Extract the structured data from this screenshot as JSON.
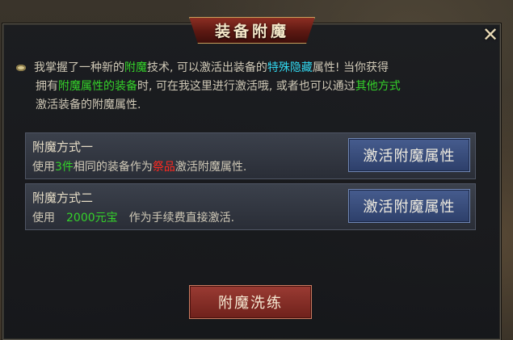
{
  "window": {
    "title": "装备附魔",
    "close_icon": "close-icon"
  },
  "intro": {
    "l1_a": "我掌握了一种新的",
    "l1_hl1": "附魔",
    "l1_b": "技术, 可以激活出装备的",
    "l1_hl2": "特殊隐藏",
    "l1_c": "属性! 当你获得",
    "l2_a": "拥有",
    "l2_hl1": "附魔属性的装备",
    "l2_b": "时, 可在我这里进行激活哦, 或者也可以通过",
    "l2_hl2": "其他方式",
    "l3": "激活装备的附魔属性."
  },
  "methods": [
    {
      "title": "附魔方式一",
      "desc_a": "使用",
      "desc_hl1": "3件",
      "desc_b": "相同的装备作为",
      "desc_hl2": "祭品",
      "desc_c": "激活附魔属性.",
      "button": "激活附魔属性"
    },
    {
      "title": "附魔方式二",
      "desc_a": "使用",
      "desc_hl1": "2000元宝",
      "desc_b": "作为手续费直接激活.",
      "button": "激活附魔属性"
    }
  ],
  "main_button": "附魔洗练",
  "colors": {
    "highlight_green": "#34d22a",
    "highlight_cyan": "#32d7ef",
    "highlight_red": "#ff2a20"
  }
}
